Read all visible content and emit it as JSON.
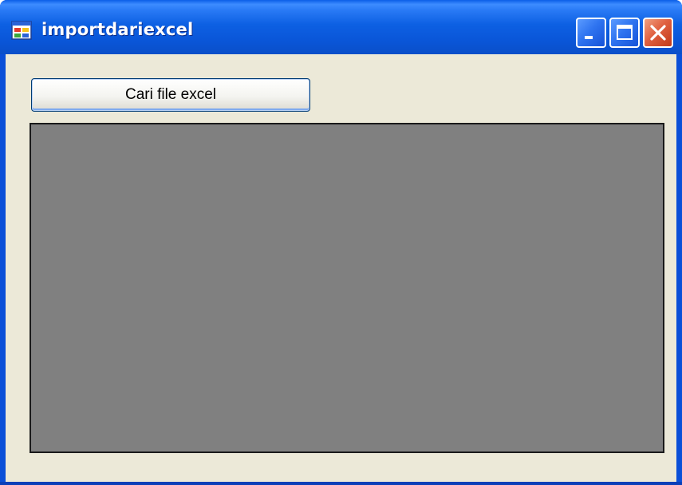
{
  "window": {
    "title": "importdariexcel",
    "icon": "app-window-icon",
    "controls": {
      "minimize": "minimize-icon",
      "maximize": "maximize-icon",
      "close": "close-icon"
    }
  },
  "main": {
    "browse_button_label": "Cari file excel",
    "grid_background": "#808080"
  },
  "colors": {
    "titlebar": "#0a5ee8",
    "client_background": "#ece9d8",
    "close_button": "#e06040"
  }
}
